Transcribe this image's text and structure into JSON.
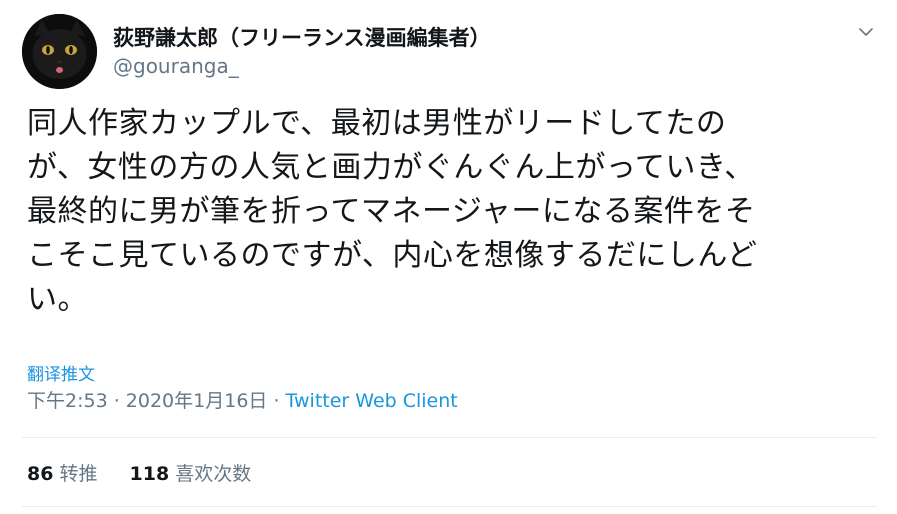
{
  "author": {
    "display_name": "荻野謙太郎（フリーランス漫画編集者）",
    "handle": "@gouranga_",
    "avatar_icon": "black-cat-avatar"
  },
  "menu": {
    "caret_icon": "chevron-down-icon"
  },
  "tweet": {
    "lines": [
      "同人作家カップルで、最初は男性がリードしてたの",
      "が、女性の方の人気と画力がぐんぐん上がっていき、",
      "最終的に男が筆を折ってマネージャーになる案件をそ",
      "こそこ見ているのですが、内心を想像するだにしんど",
      "い。"
    ]
  },
  "translate_label": "翻译推文",
  "meta": {
    "time": "下午2:53",
    "separator": " · ",
    "date": "2020年1月16日",
    "source": "Twitter Web Client"
  },
  "stats": {
    "retweets_count": "86",
    "retweets_label": "转推",
    "likes_count": "118",
    "likes_label": "喜欢次数"
  },
  "colors": {
    "text": "#14171a",
    "secondary": "#657786",
    "link": "#1b95e0",
    "divider": "#e6ecf0"
  }
}
